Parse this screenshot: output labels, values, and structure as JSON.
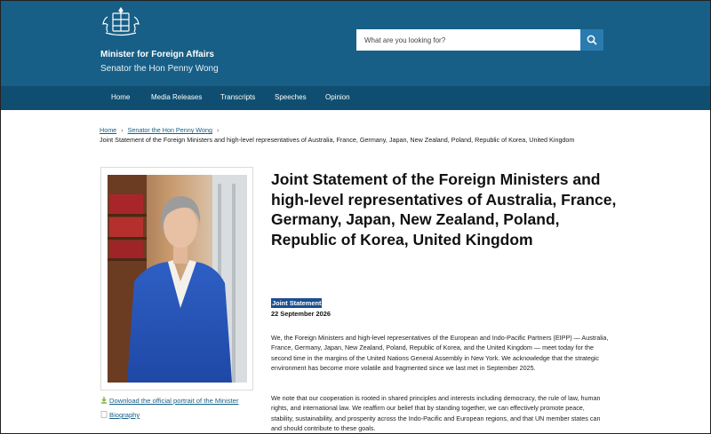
{
  "header": {
    "title": "Minister for Foreign Affairs",
    "subtitle": "Senator the Hon Penny Wong",
    "search_placeholder": "What are you looking for?"
  },
  "nav": {
    "items": [
      "Home",
      "Media Releases",
      "Transcripts",
      "Speeches",
      "Opinion"
    ]
  },
  "breadcrumb": {
    "home": "Home",
    "section": "Senator the Hon Penny Wong",
    "current": "Joint Statement of the Foreign Ministers and high-level representatives of Australia, France, Germany, Japan, New Zealand, Poland, Republic of Korea, United Kingdom"
  },
  "sidebar": {
    "download_link": "Download the official portrait of the Minister",
    "biography_link": "Biography"
  },
  "article": {
    "title": "Joint Statement of the Foreign Ministers and high-level representatives of Australia, France, Germany, Japan, New Zealand, Poland, Republic of Korea, United Kingdom",
    "tag": "Joint Statement",
    "date": "22 September 2026",
    "paragraphs": [
      "We, the Foreign Ministers and high-level representatives of the European and Indo-Pacific Partners (EIPP) — Australia, France, Germany, Japan, New Zealand, Poland, Republic of Korea, and the United Kingdom — meet today for the second time in the margins of the United Nations General Assembly in New York. We acknowledge that the strategic environment has become more volatile and fragmented since we last met in September 2025.",
      "We note that our cooperation is rooted in shared principles and interests including democracy, the rule of law, human rights, and international law. We reaffirm our belief that by standing together, we can effectively promote peace, stability, sustainability, and prosperity across the Indo-Pacific and European regions, and that UN member states can and should contribute to these goals."
    ]
  },
  "colors": {
    "header_bg": "#175f86",
    "nav_bg": "#0f4e70",
    "link": "#175f86",
    "tag_bg": "#1b4f8f"
  },
  "icons": [
    "crest-icon",
    "search-icon",
    "download-icon",
    "biography-icon"
  ]
}
